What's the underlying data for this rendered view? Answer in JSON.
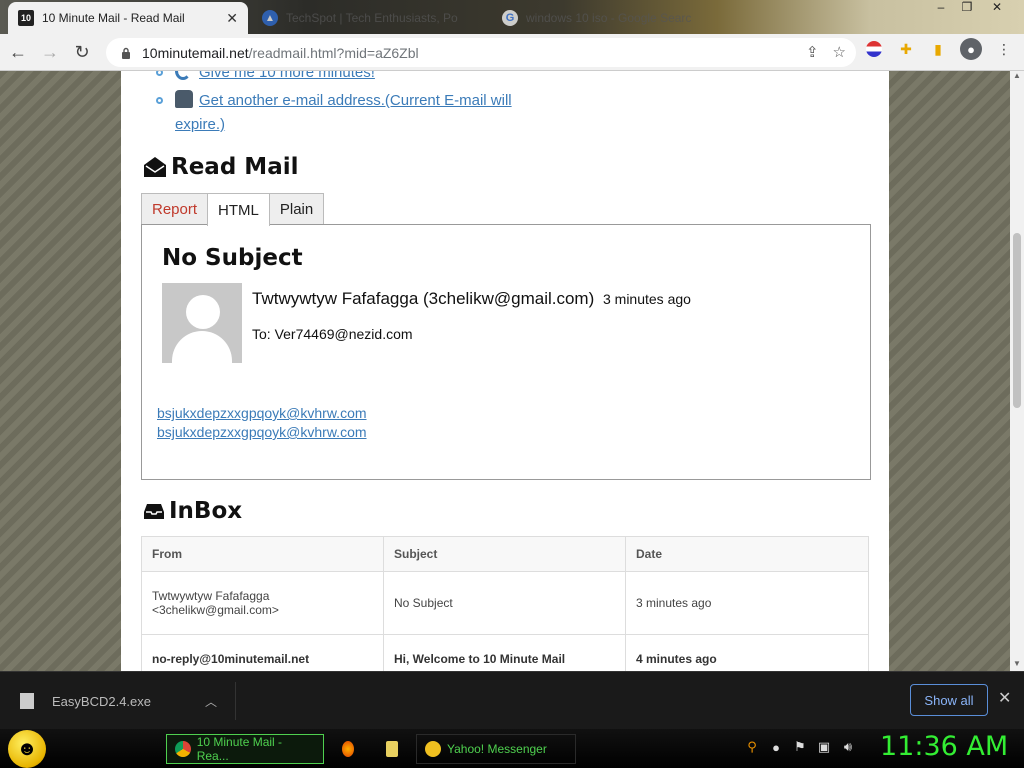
{
  "browser": {
    "tabs": [
      {
        "title": "10 Minute Mail - Read Mail",
        "favicon": "10",
        "active": true
      },
      {
        "title": "TechSpot | Tech Enthusiasts, Po",
        "active": false
      },
      {
        "title": "windows 10 iso - Google Search",
        "favicon": "G",
        "active": false
      }
    ],
    "url_host": "10minutemail.net",
    "url_path": "/readmail.html?mid=aZ6Zbl",
    "icons": [
      "back-icon",
      "forward-icon",
      "reload-icon",
      "lock-icon",
      "share-icon",
      "star-icon",
      "extension-icon",
      "puzzle-icon",
      "sidepanel-icon",
      "profile-icon",
      "menu-icon"
    ]
  },
  "page": {
    "links": [
      {
        "label": "Give me 10 more minutes!"
      },
      {
        "label": "Get another e-mail address.(Current E-mail will expire.)"
      }
    ],
    "read_mail": {
      "title": "Read Mail",
      "tabs": [
        "Report",
        "HTML",
        "Plain"
      ],
      "active_tab": "HTML",
      "subject": "No Subject",
      "sender": "Twtwywtyw Fafafagga (3chelikw@gmail.com)",
      "time_ago": "3 minutes ago",
      "to": "To: Ver74469@nezid.com",
      "body_links": [
        "bsjukxdepzxxgpqoyk@kvhrw.com",
        "bsjukxdepzxxgpqoyk@kvhrw.com"
      ]
    },
    "inbox": {
      "title": "InBox",
      "columns": [
        "From",
        "Subject",
        "Date"
      ],
      "rows": [
        {
          "from": "Twtwywtyw Fafafagga <3chelikw@gmail.com>",
          "subject": "No Subject",
          "date": "3 minutes ago"
        },
        {
          "from": "no-reply@10minutemail.net",
          "subject": "Hi, Welcome to 10 Minute Mail",
          "date": "4 minutes ago"
        }
      ]
    }
  },
  "download_bar": {
    "file": "EasyBCD2.4.exe",
    "show_all": "Show all"
  },
  "taskbar": {
    "items": [
      {
        "label": "10 Minute Mail - Rea..."
      },
      {
        "label": "Yahoo! Messenger"
      }
    ],
    "clock": "11:36 AM"
  },
  "colors": {
    "link": "#3b7bb8",
    "report_tab": "#c0392b",
    "clock": "#33ee33",
    "taskbar_text": "#4fd04f"
  }
}
